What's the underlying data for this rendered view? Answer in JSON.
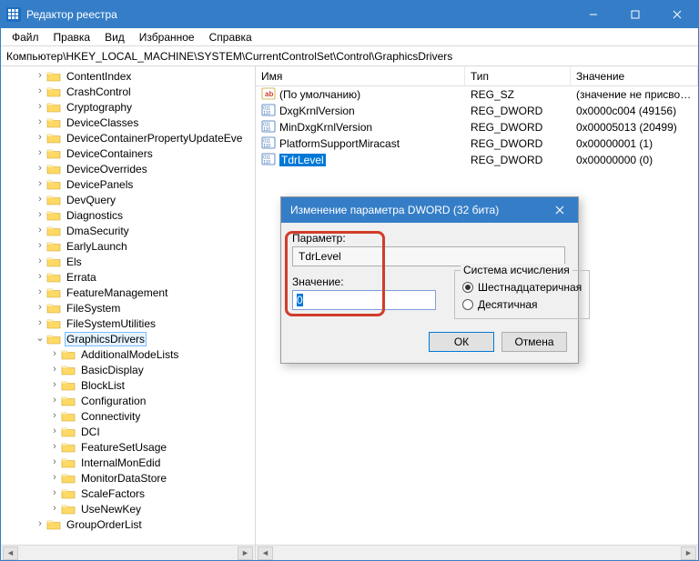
{
  "titlebar": {
    "title": "Редактор реестра"
  },
  "menu": {
    "file": "Файл",
    "edit": "Правка",
    "view": "Вид",
    "fav": "Избранное",
    "help": "Справка"
  },
  "address": "Компьютер\\HKEY_LOCAL_MACHINE\\SYSTEM\\CurrentControlSet\\Control\\GraphicsDrivers",
  "tree": {
    "level2": [
      "ContentIndex",
      "CrashControl",
      "Cryptography",
      "DeviceClasses",
      "DeviceContainerPropertyUpdateEve",
      "DeviceContainers",
      "DeviceOverrides",
      "DevicePanels",
      "DevQuery",
      "Diagnostics",
      "DmaSecurity",
      "EarlyLaunch",
      "Els",
      "Errata",
      "FeatureManagement",
      "FileSystem",
      "FileSystemUtilities",
      "GraphicsDrivers"
    ],
    "selectedIndex": 17,
    "level3": [
      "AdditionalModeLists",
      "BasicDisplay",
      "BlockList",
      "Configuration",
      "Connectivity",
      "DCI",
      "FeatureSetUsage",
      "InternalMonEdid",
      "MonitorDataStore",
      "ScaleFactors",
      "UseNewKey"
    ],
    "trailing": "GroupOrderList"
  },
  "list": {
    "cols": {
      "name": "Имя",
      "type": "Тип",
      "value": "Значение"
    },
    "rows": [
      {
        "icon": "str",
        "name": "(По умолчанию)",
        "type": "REG_SZ",
        "value": "(значение не присвоено)"
      },
      {
        "icon": "bin",
        "name": "DxgKrnlVersion",
        "type": "REG_DWORD",
        "value": "0x0000c004 (49156)"
      },
      {
        "icon": "bin",
        "name": "MinDxgKrnlVersion",
        "type": "REG_DWORD",
        "value": "0x00005013 (20499)"
      },
      {
        "icon": "bin",
        "name": "PlatformSupportMiracast",
        "type": "REG_DWORD",
        "value": "0x00000001 (1)"
      },
      {
        "icon": "bin",
        "name": "TdrLevel",
        "type": "REG_DWORD",
        "value": "0x00000000 (0)"
      }
    ],
    "selectedIndex": 4
  },
  "dialog": {
    "title": "Изменение параметра DWORD (32 бита)",
    "param_label": "Параметр:",
    "param_value": "TdrLevel",
    "value_label": "Значение:",
    "value_value": "0",
    "base_label": "Система исчисления",
    "radio_hex": "Шестнадцатеричная",
    "radio_dec": "Десятичная",
    "ok": "ОК",
    "cancel": "Отмена"
  }
}
